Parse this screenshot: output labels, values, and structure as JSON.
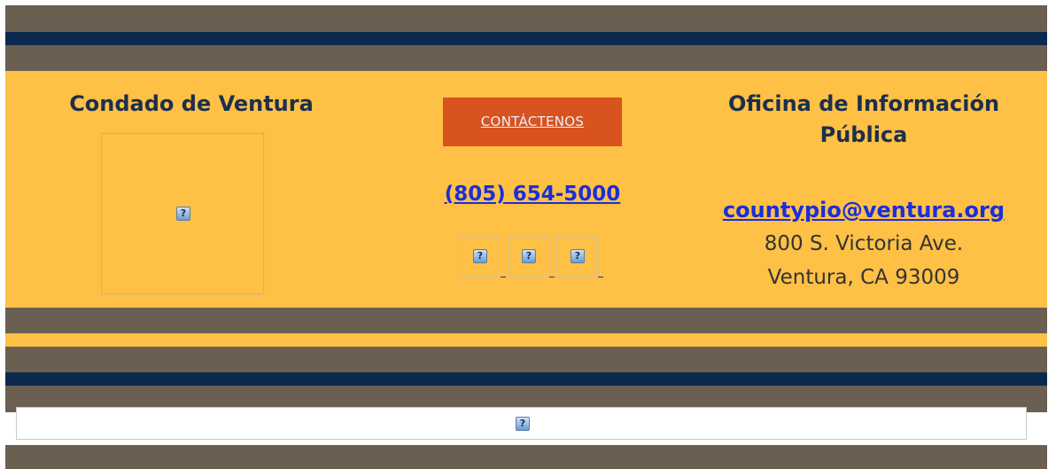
{
  "left_column": {
    "title": "Condado de Ventura",
    "logo_icon": "broken-image-icon"
  },
  "center_column": {
    "contact_label": "CONTÁCTENOS",
    "phone": "(805) 654-5000",
    "social_icons": [
      "broken-image-icon",
      "broken-image-icon",
      "broken-image-icon"
    ]
  },
  "right_column": {
    "title_line1": "Oficina de Información",
    "title_line2": "Pública",
    "email": "countypio@ventura.org",
    "address_line1": "800 S. Victoria Ave.",
    "address_line2": "Ventura, CA 93009"
  },
  "footer": {
    "banner_icon": "broken-image-icon"
  },
  "icon_glyph": "?",
  "colors": {
    "brown": "#6b5f52",
    "navy": "#0c2a4d",
    "gold": "#fec045",
    "orange_button": "#d9531e",
    "link_blue": "#1a2edb",
    "heading": "#1c2f4d"
  }
}
